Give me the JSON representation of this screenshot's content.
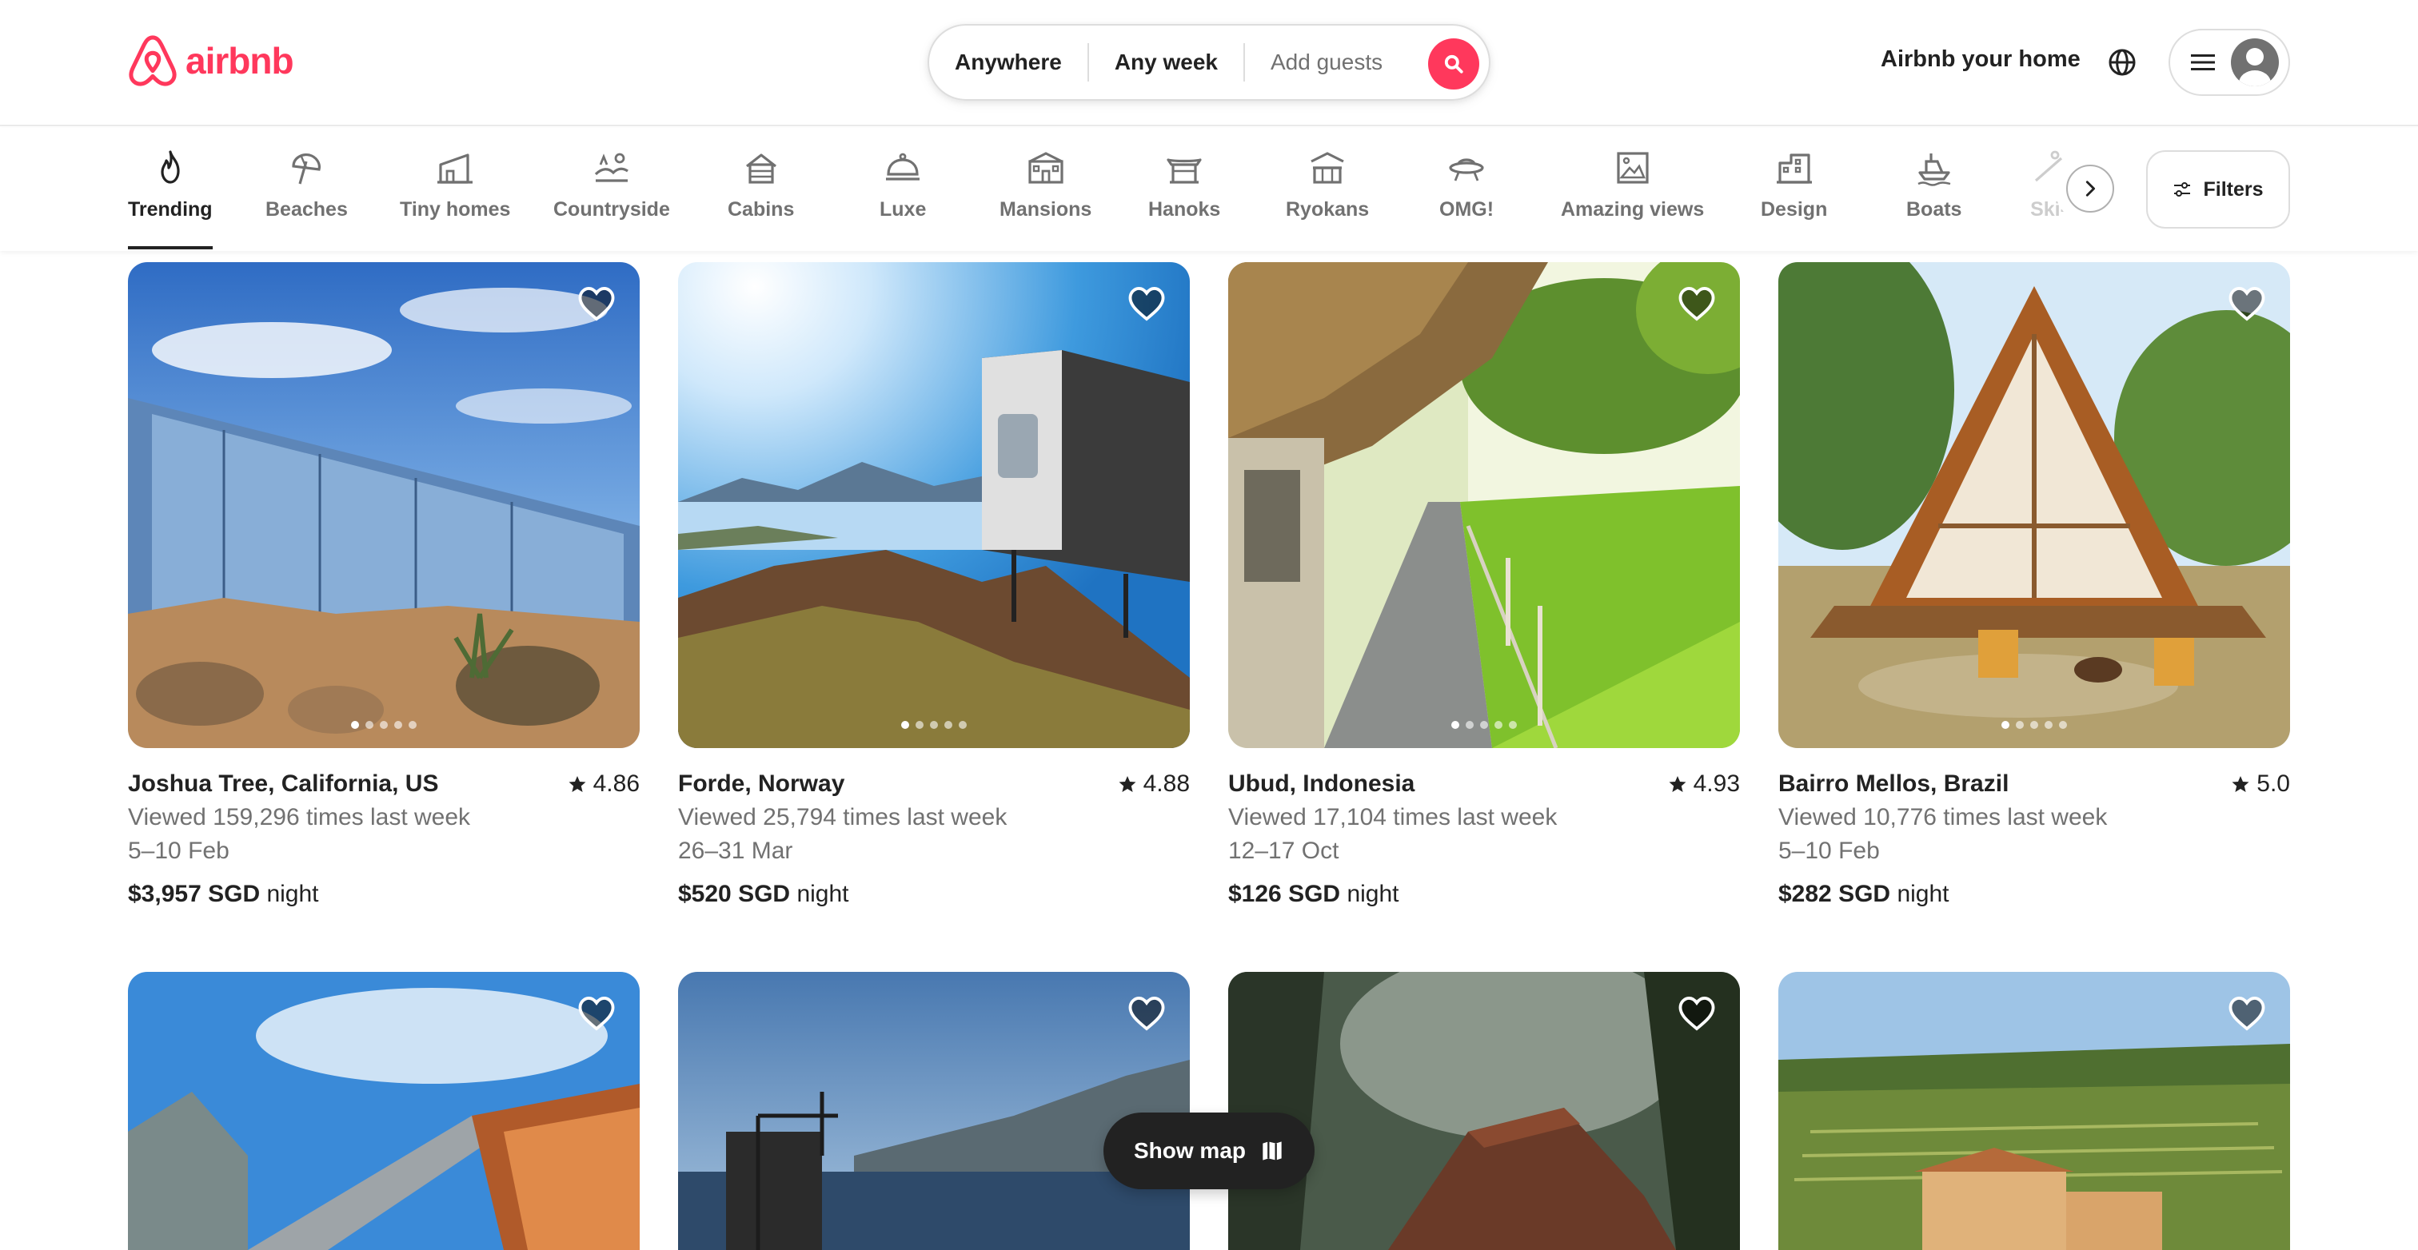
{
  "header": {
    "logo_text": "airbnb",
    "search": {
      "where": "Anywhere",
      "when": "Any week",
      "who": "Add guests"
    },
    "host_link": "Airbnb your home",
    "icons": {
      "globe": "globe-icon",
      "menu": "hamburger-icon",
      "avatar": "user-avatar-icon"
    }
  },
  "categories": [
    {
      "label": "Trending",
      "icon": "flame-icon",
      "active": true
    },
    {
      "label": "Beaches",
      "icon": "umbrella-icon"
    },
    {
      "label": "Tiny homes",
      "icon": "tiny-home-icon"
    },
    {
      "label": "Countryside",
      "icon": "countryside-icon"
    },
    {
      "label": "Cabins",
      "icon": "cabin-icon"
    },
    {
      "label": "Luxe",
      "icon": "cloche-icon"
    },
    {
      "label": "Mansions",
      "icon": "mansion-icon"
    },
    {
      "label": "Hanoks",
      "icon": "hanok-icon"
    },
    {
      "label": "Ryokans",
      "icon": "ryokan-icon"
    },
    {
      "label": "OMG!",
      "icon": "ufo-icon"
    },
    {
      "label": "Amazing views",
      "icon": "picture-frame-icon"
    },
    {
      "label": "Design",
      "icon": "design-building-icon"
    },
    {
      "label": "Boats",
      "icon": "boat-icon"
    },
    {
      "label": "Ski-",
      "icon": "ski-icon",
      "faded": true
    }
  ],
  "filters_label": "Filters",
  "listings": [
    {
      "title": "Joshua Tree, California, US",
      "rating": "4.86",
      "views": "Viewed 159,296 times last week",
      "dates": "5–10 Feb",
      "price": "$3,957 SGD",
      "unit": "night"
    },
    {
      "title": "Forde, Norway",
      "rating": "4.88",
      "views": "Viewed 25,794 times last week",
      "dates": "26–31 Mar",
      "price": "$520 SGD",
      "unit": "night"
    },
    {
      "title": "Ubud, Indonesia",
      "rating": "4.93",
      "views": "Viewed 17,104 times last week",
      "dates": "12–17 Oct",
      "price": "$126 SGD",
      "unit": "night"
    },
    {
      "title": "Bairro Mellos, Brazil",
      "rating": "5.0",
      "views": "Viewed 10,776 times last week",
      "dates": "5–10 Feb",
      "price": "$282 SGD",
      "unit": "night"
    }
  ],
  "show_map_label": "Show map",
  "colors": {
    "brand": "#ff385c",
    "text": "#222222",
    "muted": "#717171",
    "border": "#dddddd"
  }
}
